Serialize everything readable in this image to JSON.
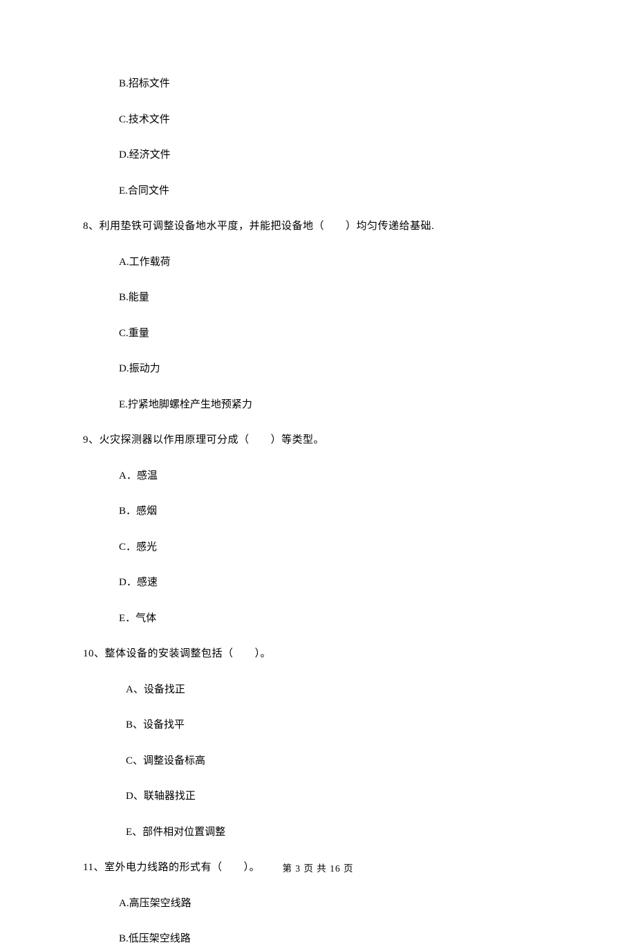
{
  "q7_tail": {
    "optB": "B.招标文件",
    "optC": "C.技术文件",
    "optD": "D.经济文件",
    "optE": "E.合同文件"
  },
  "q8": {
    "stem": "8、利用垫铁可调整设备地水平度，并能把设备地（　　）均匀传递给基础.",
    "optA": "A.工作载荷",
    "optB": "B.能量",
    "optC": "C.重量",
    "optD": "D.振动力",
    "optE": "E.拧紧地脚螺栓产生地预紧力"
  },
  "q9": {
    "stem": "9、火灾探测器以作用原理可分成（　　）等类型。",
    "optA": "A．感温",
    "optB": "B．感烟",
    "optC": "C．感光",
    "optD": "D．感速",
    "optE": "E．气体"
  },
  "q10": {
    "stem": "10、整体设备的安装调整包括（　　）。",
    "optA": "A、设备找正",
    "optB": "B、设备找平",
    "optC": "C、调整设备标高",
    "optD": "D、联轴器找正",
    "optE": "E、部件相对位置调整"
  },
  "q11": {
    "stem": "11、室外电力线路的形式有（　　）。",
    "optA": "A.高压架空线路",
    "optB": "B.低压架空线路"
  },
  "footer": "第 3 页 共 16 页"
}
